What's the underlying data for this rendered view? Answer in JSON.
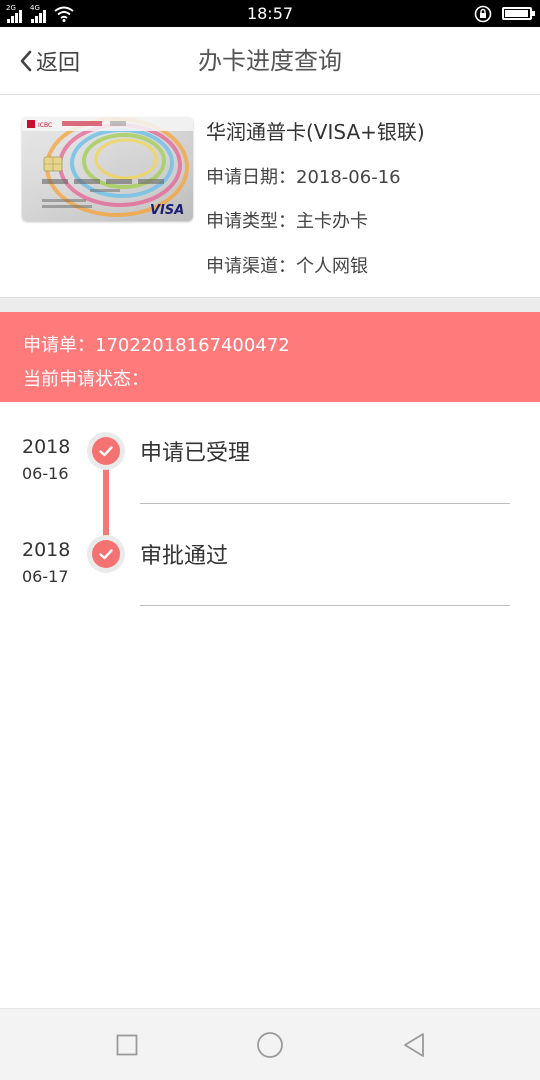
{
  "status_bar": {
    "time": "18:57",
    "sim1_label": "2G",
    "sim2_label": "4G",
    "battery_level": 0.95
  },
  "header": {
    "back_label": "返回",
    "title": "办卡进度查询"
  },
  "card": {
    "name": "华润通普卡(VISA+银联)",
    "image_texts": {
      "bank": "ICBC",
      "brand": "VISA"
    },
    "apply_date_label": "申请日期：",
    "apply_date": "2018-06-16",
    "apply_type_label": "申请类型：",
    "apply_type": "主卡办卡",
    "channel_label": "申请渠道：",
    "channel": "个人网银"
  },
  "application": {
    "number_label": "申请单：",
    "number": "17022018167400472",
    "status_label": "当前申请状态："
  },
  "timeline": [
    {
      "year": "2018",
      "date": "06-16",
      "label": "申请已受理"
    },
    {
      "year": "2018",
      "date": "06-17",
      "label": "审批通过"
    }
  ],
  "colors": {
    "accent": "#ff7b7b",
    "dot": "#f47272",
    "timeline_line": "#f37878"
  },
  "icons": {
    "back": "chevron-left-icon",
    "check": "check-icon",
    "nav_recent": "square-icon",
    "nav_home": "circle-icon",
    "nav_back": "triangle-left-icon"
  }
}
